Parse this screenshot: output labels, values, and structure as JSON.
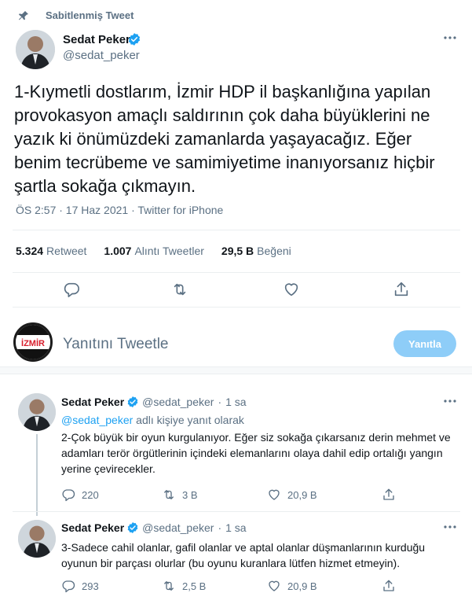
{
  "pinned": {
    "label": "Sabitlenmiş Tweet",
    "icon": "pin-icon"
  },
  "main_tweet": {
    "author_name": "Sedat Peker",
    "author_handle": "@sedat_peker",
    "verified_icon": "verified-badge-icon",
    "text": "1-Kıymetli dostlarım, İzmir HDP il başkanlığına yapılan provokasyon amaçlı saldırının çok daha büyüklerini ne yazık ki önümüzdeki zamanlarda yaşayacağız. Eğer benim tecrübeme ve samimiyetime inanıyorsanız hiçbir şartla sokağa çıkmayın.",
    "meta": "ÖS 2:57 · 17 Haz 2021 · Twitter for iPhone",
    "stats": [
      {
        "value": "5.324",
        "label": "Retweet"
      },
      {
        "value": "1.007",
        "label": "Alıntı Tweetler"
      },
      {
        "value": "29,5 B",
        "label": "Beğeni"
      }
    ]
  },
  "composer": {
    "avatar_text": "İZMİR",
    "placeholder": "Yanıtını Tweetle",
    "button_label": "Yanıtla"
  },
  "thread": [
    {
      "author_name": "Sedat Peker",
      "author_handle": "@sedat_peker",
      "dot": "·",
      "time": "1 sa",
      "reply_to_handle": "@sedat_peker",
      "reply_to_suffix": " adlı kişiye yanıt olarak",
      "text": "2-Çok büyük bir oyun kurgulanıyor. Eğer siz sokağa çıkarsanız derin mehmet ve adamları terör örgütlerinin içindeki elemanlarını olaya dahil edip ortalığı yangın yerine çevirecekler.",
      "replies": "220",
      "retweets": "3 B",
      "likes": "20,9 B"
    },
    {
      "author_name": "Sedat Peker",
      "author_handle": "@sedat_peker",
      "dot": "·",
      "time": "1 sa",
      "text": "3-Sadece cahil olanlar, gafil olanlar ve aptal olanlar düşmanlarının kurduğu oyunun bir parçası olurlar (bu oyunu kuranlara lütfen hizmet etmeyin).",
      "replies": "293",
      "retweets": "2,5 B",
      "likes": "20,9 B"
    }
  ],
  "colors": {
    "accent": "#1da1f2",
    "muted_text": "#5b7083",
    "button_disabled": "#8ecdf8",
    "divider": "#ebeef0"
  }
}
